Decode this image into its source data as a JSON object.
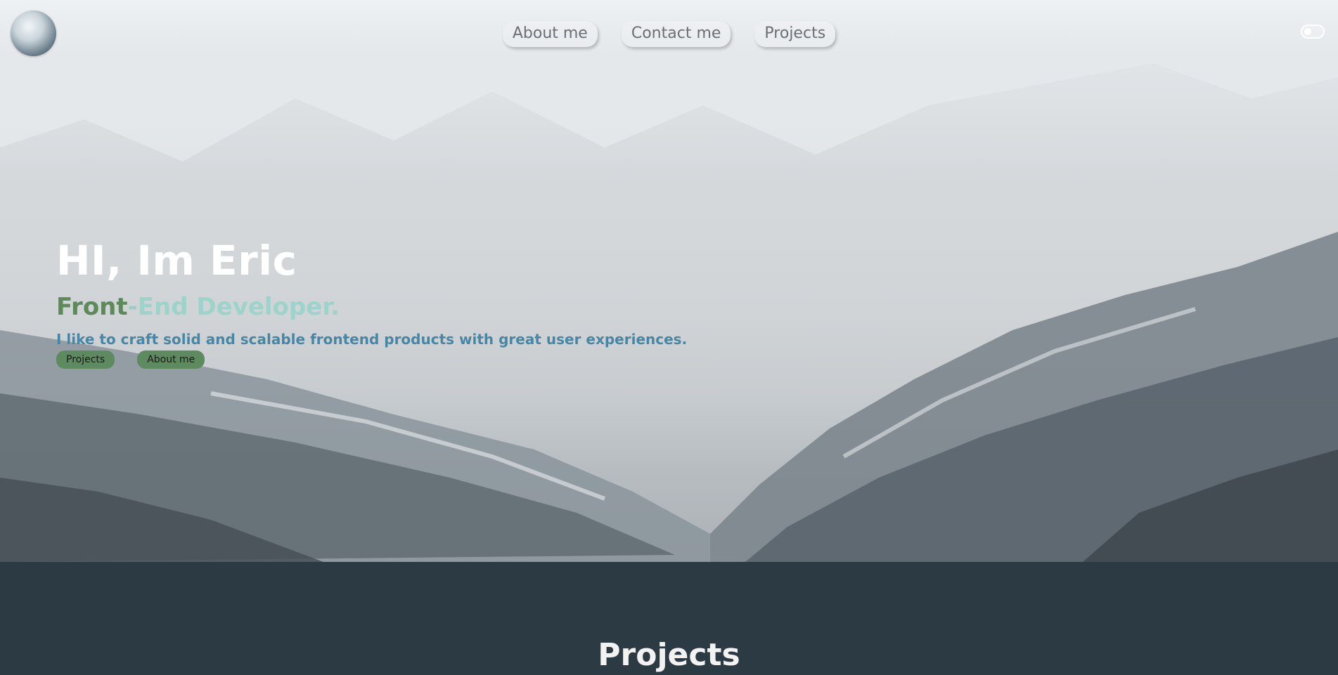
{
  "nav": {
    "links": [
      {
        "label": "About me"
      },
      {
        "label": "Contact me"
      },
      {
        "label": "Projects"
      }
    ],
    "logo_icon": "mountain-avatar-icon",
    "theme_toggle_icon": "toggle-icon"
  },
  "hero": {
    "greeting": "HI, Im Eric",
    "role_front": "Front",
    "role_separator": "-",
    "role_rest": "End Developer.",
    "tagline": "I like to craft solid and scalable frontend products with great user experiences.",
    "buttons": {
      "projects": "Projects",
      "about": "About me"
    }
  },
  "projects": {
    "title": "Projects"
  },
  "colors": {
    "greeting": "#ffffff",
    "role_front": "#5c8a58",
    "role_rest": "#9cd4cc",
    "tagline": "#4787a6",
    "cta_bg": "#5d8a5e",
    "section_bg": "#2c3a44"
  }
}
